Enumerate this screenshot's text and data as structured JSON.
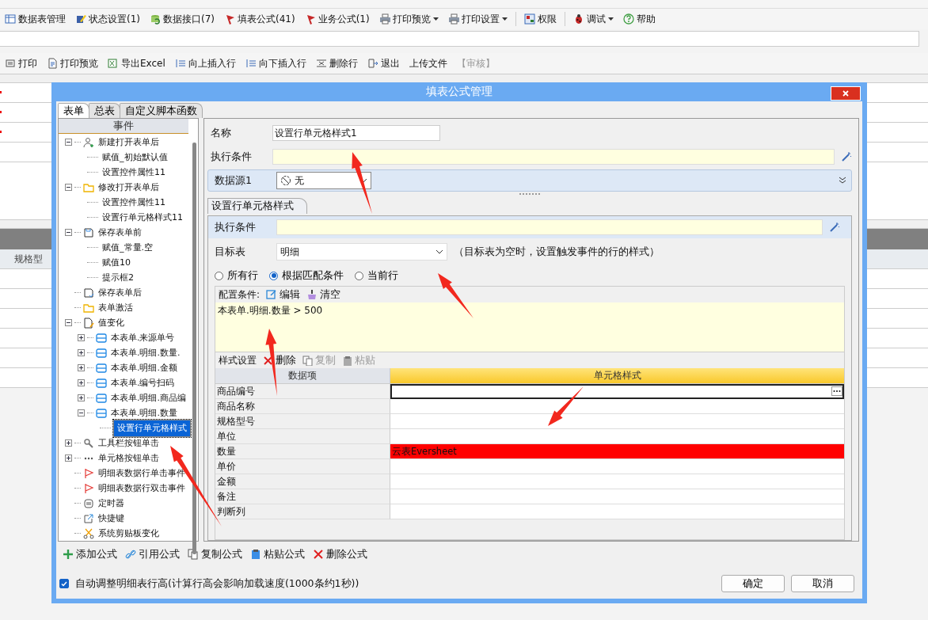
{
  "app": {
    "toolbar": [
      {
        "label": "数据表管理"
      },
      {
        "label": "状态设置(1)"
      },
      {
        "label": "数据接口(7)"
      },
      {
        "label": "填表公式(41)"
      },
      {
        "label": "业务公式(1)"
      },
      {
        "label": "打印预览",
        "dropdown": true
      },
      {
        "label": "打印设置",
        "dropdown": true
      },
      {
        "label": "权限"
      },
      {
        "label": "调试",
        "dropdown": true
      },
      {
        "label": "帮助"
      }
    ],
    "form_toolbar": [
      {
        "label": "打印",
        "disabled": false
      },
      {
        "label": "打印预览",
        "disabled": false
      },
      {
        "label": "导出Excel",
        "disabled": false
      },
      {
        "label": "向上插入行",
        "disabled": false
      },
      {
        "label": "向下插入行",
        "disabled": false
      },
      {
        "label": "删除行",
        "disabled": false
      },
      {
        "label": "退出",
        "disabled": false
      },
      {
        "label": "上传文件",
        "disabled": false
      },
      {
        "label": "【审核】",
        "disabled": true
      }
    ],
    "grid_header": "规格型"
  },
  "dialog": {
    "title": "填表公式管理",
    "tabs": [
      {
        "label": "表单",
        "selected": true
      },
      {
        "label": "总表",
        "selected": false
      },
      {
        "label": "自定义脚本函数",
        "selected": false
      }
    ],
    "tree": {
      "header": "事件",
      "items": [
        {
          "label": "新建打开表单后",
          "kind": "event",
          "expanded": true,
          "selected": false,
          "children": [
            {
              "label": "赋值_初始默认值",
              "kind": "action",
              "selected": false
            },
            {
              "label": "设置控件属性11",
              "kind": "action",
              "selected": false
            }
          ]
        },
        {
          "label": "修改打开表单后",
          "kind": "event",
          "expanded": true,
          "selected": false,
          "children": [
            {
              "label": "设置控件属性11",
              "kind": "action",
              "selected": false
            },
            {
              "label": "设置行单元格样式11",
              "kind": "action",
              "selected": false
            }
          ]
        },
        {
          "label": "保存表单前",
          "kind": "event",
          "expanded": true,
          "selected": false,
          "children": [
            {
              "label": "赋值_常量.空",
              "kind": "action",
              "selected": false
            },
            {
              "label": "赋值10",
              "kind": "action",
              "selected": false
            },
            {
              "label": "提示框2",
              "kind": "action",
              "selected": false
            }
          ]
        },
        {
          "label": "保存表单后",
          "kind": "event",
          "selected": false
        },
        {
          "label": "表单激活",
          "kind": "event",
          "selected": false
        },
        {
          "label": "值变化",
          "kind": "event",
          "expanded": true,
          "selected": false,
          "children": [
            {
              "label": "本表单.来源单号",
              "kind": "field",
              "expanded": false,
              "selected": false
            },
            {
              "label": "本表单.明细.数量.",
              "kind": "field",
              "expanded": false,
              "selected": false
            },
            {
              "label": "本表单.明细.金额",
              "kind": "field",
              "expanded": false,
              "selected": false
            },
            {
              "label": "本表单.编号扫码",
              "kind": "field",
              "expanded": false,
              "selected": false
            },
            {
              "label": "本表单.明细.商品编",
              "kind": "field",
              "expanded": false,
              "selected": false
            },
            {
              "label": "本表单.明细.数量",
              "kind": "field",
              "expanded": true,
              "selected": false,
              "children": [
                {
                  "label": "设置行单元格样式",
                  "kind": "action",
                  "selected": true
                }
              ]
            }
          ]
        },
        {
          "label": "工具栏按钮单击",
          "kind": "event",
          "expanded": false,
          "selected": false
        },
        {
          "label": "单元格按钮单击",
          "kind": "event",
          "expanded": false,
          "selected": false
        },
        {
          "label": "明细表数据行单击事件",
          "kind": "event",
          "selected": false
        },
        {
          "label": "明细表数据行双击事件",
          "kind": "event",
          "selected": false
        },
        {
          "label": "定时器",
          "kind": "event",
          "selected": false
        },
        {
          "label": "快捷键",
          "kind": "event",
          "selected": false
        },
        {
          "label": "系统剪贴板变化",
          "kind": "event",
          "selected": false
        }
      ]
    },
    "form": {
      "name_label": "名称",
      "name_value": "设置行单元格样式1",
      "condition_label": "执行条件",
      "datasource_label": "数据源1",
      "datasource_value": "无",
      "section_tab": "设置行单元格样式",
      "inner_condition_label": "执行条件",
      "target_label": "目标表",
      "target_value": "明细",
      "target_hint": "（目标表为空时，设置触发事件的行的样式）",
      "radios": [
        {
          "label": "所有行",
          "selected": false
        },
        {
          "label": "根据匹配条件",
          "selected": true
        },
        {
          "label": "当前行",
          "selected": false
        }
      ],
      "config_label": "配置条件:",
      "config_actions": [
        {
          "label": "编辑"
        },
        {
          "label": "清空"
        }
      ],
      "condition_text": "本表单.明细.数量  > 500",
      "style_label": "样式设置",
      "style_actions": [
        {
          "label": "删除",
          "disabled": false
        },
        {
          "label": "复制",
          "disabled": true
        },
        {
          "label": "粘贴",
          "disabled": true
        }
      ],
      "grid": {
        "columns": [
          "数据项",
          "单元格样式"
        ],
        "rows": [
          {
            "item": "商品编号",
            "selected": true
          },
          {
            "item": "商品名称",
            "selected": false
          },
          {
            "item": "规格型号",
            "selected": false
          },
          {
            "item": "单位",
            "selected": false
          },
          {
            "item": "数量",
            "selected": false,
            "style": {
              "text": "云表Eversheet",
              "color": "#ff0000"
            }
          },
          {
            "item": "单价",
            "selected": false
          },
          {
            "item": "金额",
            "selected": false
          },
          {
            "item": "备注",
            "selected": false
          },
          {
            "item": "判断列",
            "selected": false
          }
        ]
      }
    },
    "formula_actions": [
      {
        "label": "添加公式"
      },
      {
        "label": "引用公式"
      },
      {
        "label": "复制公式"
      },
      {
        "label": "粘贴公式"
      },
      {
        "label": "删除公式"
      }
    ],
    "auto_height": {
      "label": "自动调整明细表行高(计算行高会影响加载速度(1000条约1秒))",
      "checked": true
    },
    "buttons": [
      {
        "label": "确定"
      },
      {
        "label": "取消"
      }
    ]
  }
}
